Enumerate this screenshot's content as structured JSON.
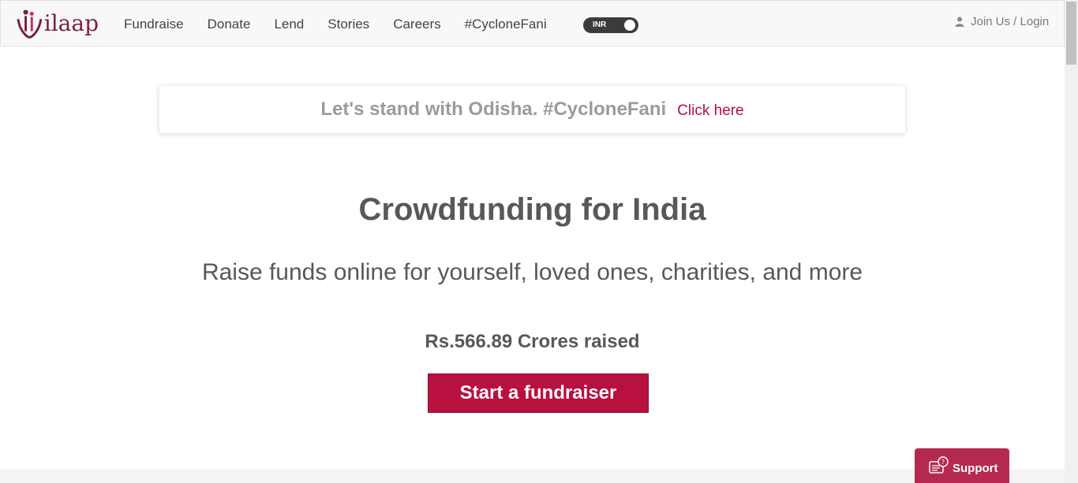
{
  "header": {
    "logo_text": "ilaap",
    "nav": [
      "Fundraise",
      "Donate",
      "Lend",
      "Stories",
      "Careers",
      "#CycloneFani"
    ],
    "currency_toggle": "INR",
    "login": "Join Us / Login"
  },
  "banner": {
    "text": "Let's stand with Odisha. #CycloneFani",
    "link": "Click here"
  },
  "hero": {
    "title": "Crowdfunding for India",
    "subtitle": "Raise funds online for yourself, loved ones, charities, and more",
    "raised": "Rs.566.89 Crores raised",
    "cta": "Start a fundraiser"
  },
  "support": {
    "label": "Support"
  },
  "colors": {
    "brand": "#b8103f",
    "logo": "#7a1f3d",
    "support": "#b6294f"
  }
}
